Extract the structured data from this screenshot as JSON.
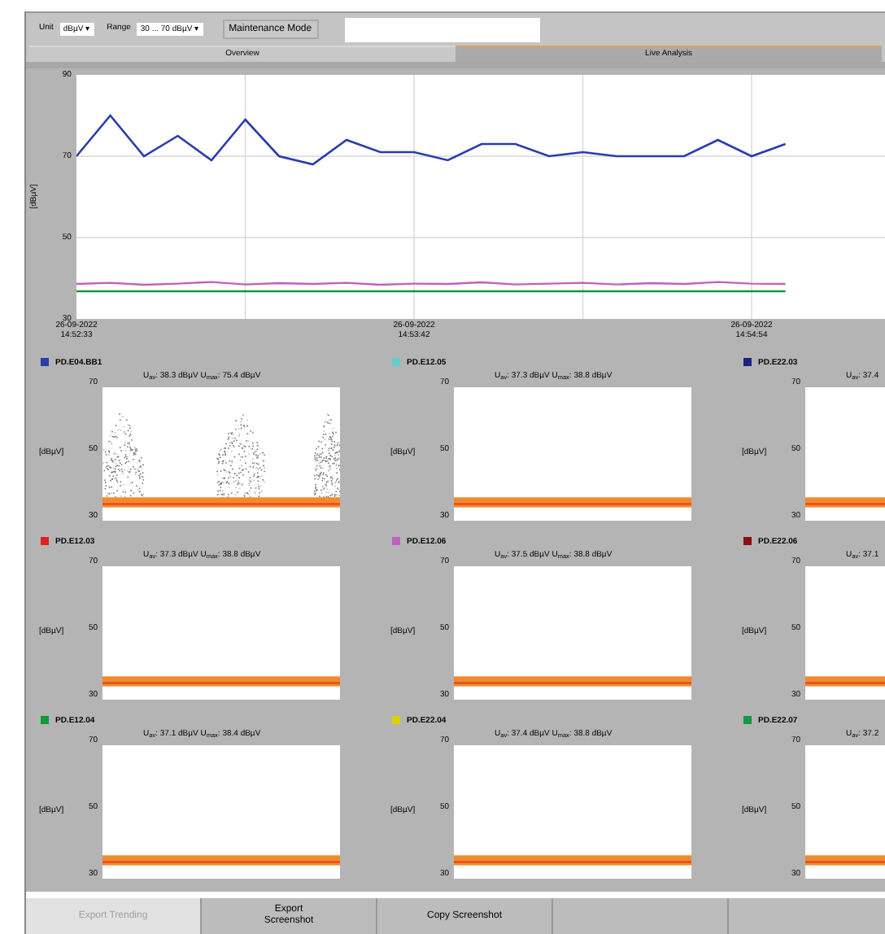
{
  "toolbar": {
    "unit": {
      "label": "Unit",
      "value": "dBµV ▾"
    },
    "range": {
      "label": "Range",
      "value": "30 ... 70 dBµV ▾"
    },
    "mode_button": "Maintenance Mode"
  },
  "tabs": [
    {
      "label": "Overview",
      "selected": false
    },
    {
      "label": "Live Analysis",
      "selected": true
    }
  ],
  "trend_chart": {
    "chart_data": {
      "type": "line",
      "grid": true,
      "ylabel": "[dBµV]",
      "categories": [
        "26-09-2022 14:52:33",
        null,
        null,
        null,
        null,
        null,
        null,
        null,
        null,
        null,
        "26-09-2022 14:53:42",
        null,
        null,
        null,
        null,
        null,
        null,
        null,
        null,
        null,
        "26-09-2022 14:54:54",
        null,
        null,
        null,
        null
      ],
      "ylim": [
        30,
        90
      ],
      "yticks": [
        90,
        70,
        50,
        30
      ],
      "series": [
        {
          "color": "#2a3cae",
          "values": [
            70,
            80,
            70,
            75,
            69,
            79,
            70,
            68,
            74,
            71,
            71,
            69,
            73,
            73,
            70,
            71,
            70,
            70,
            70,
            74,
            70,
            73,
            null,
            null,
            null
          ]
        },
        {
          "color": "#c060c0",
          "values": [
            38.6,
            38.9,
            38.4,
            38.7,
            39.1,
            38.5,
            38.8,
            38.6,
            38.9,
            38.4,
            38.7,
            38.6,
            39,
            38.5,
            38.7,
            38.9,
            38.5,
            38.8,
            38.6,
            39.1,
            38.7,
            38.6,
            null,
            null,
            null
          ]
        },
        {
          "color": "#119933",
          "values": [
            36.8,
            36.8,
            36.8,
            36.8,
            36.8,
            36.8,
            36.8,
            36.8,
            36.8,
            36.8,
            36.8,
            36.8,
            36.8,
            36.8,
            36.8,
            36.8,
            36.8,
            36.8,
            36.8,
            36.8,
            36.8,
            36.8,
            null,
            null,
            null
          ]
        }
      ]
    }
  },
  "channels": [
    {
      "name": "PD.E04.BB1",
      "color": "#2a3cae",
      "kind": "scatter",
      "stats": "U$_{av}$: 38.3 dBµV  U$_{max}$: 75.4 dBµV",
      "y_labels": [
        "70",
        "50",
        "30"
      ],
      "unit": "[dBµV]"
    },
    {
      "name": "PD.E12.05",
      "color": "#66cccc",
      "kind": "flat",
      "stats": "U$_{av}$: 37.3 dBµV  U$_{max}$: 38.8 dBµV",
      "y_labels": [
        "70",
        "50",
        "30"
      ],
      "unit": "[dBµV]"
    },
    {
      "name": "PD.E22.03",
      "color": "#1a237e",
      "kind": "flat",
      "stats": "U$_{av}$: 37.4",
      "y_labels": [
        "70",
        "50",
        "30"
      ],
      "unit": "[dBµV]"
    },
    {
      "name": "PD.E12.03",
      "color": "#e02020",
      "kind": "flat",
      "stats": "U$_{av}$: 37.3 dBµV  U$_{max}$: 38.8 dBµV",
      "y_labels": [
        "70",
        "50",
        "30"
      ],
      "unit": "[dBµV]"
    },
    {
      "name": "PD.E12.06",
      "color": "#c060c0",
      "kind": "flat",
      "stats": "U$_{av}$: 37.5 dBµV  U$_{max}$: 38.8 dBµV",
      "y_labels": [
        "70",
        "50",
        "30"
      ],
      "unit": "[dBµV]"
    },
    {
      "name": "PD.E22.06",
      "color": "#881111",
      "kind": "flat",
      "stats": "U$_{av}$: 37.1",
      "y_labels": [
        "70",
        "50",
        "30"
      ],
      "unit": "[dBµV]"
    },
    {
      "name": "PD.E12.04",
      "color": "#119933",
      "kind": "flat",
      "stats": "U$_{av}$: 37.1 dBµV  U$_{max}$: 38.4 dBµV",
      "y_labels": [
        "70",
        "50",
        "30"
      ],
      "unit": "[dBµV]"
    },
    {
      "name": "PD.E22.04",
      "color": "#e0d000",
      "kind": "flat",
      "stats": "U$_{av}$: 37.4 dBµV  U$_{max}$: 38.8 dBµV",
      "y_labels": [
        "70",
        "50",
        "30"
      ],
      "unit": "[dBµV]"
    },
    {
      "name": "PD.E22.07",
      "color": "#119944",
      "kind": "flat",
      "stats": "U$_{av}$: 37.2",
      "y_labels": [
        "70",
        "50",
        "30"
      ],
      "unit": "[dBµV]"
    }
  ],
  "buttons": [
    {
      "label": "Export Trending",
      "disabled": true
    },
    {
      "label": "Export Screenshot",
      "disabled": false
    },
    {
      "label": "Copy Screenshot",
      "disabled": false
    },
    {
      "disabled": false
    },
    {
      "disabled": false
    }
  ]
}
